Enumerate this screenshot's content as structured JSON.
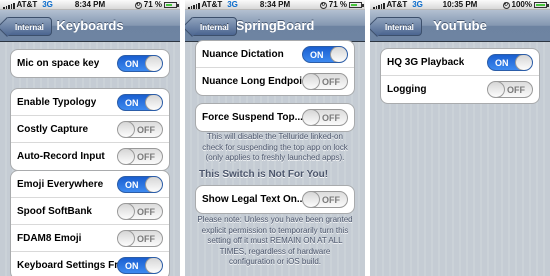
{
  "panels": [
    {
      "status": {
        "carrier": "AT&T",
        "network": "3G",
        "time": "8:34 PM",
        "battery": "71 %",
        "battery_level": 0.71
      },
      "nav": {
        "back_label": "Internal",
        "title": "Keyboards"
      },
      "groups": [
        [
          {
            "label": "Mic on space key",
            "state": "ON"
          }
        ],
        [
          {
            "label": "Enable Typology",
            "state": "ON"
          },
          {
            "label": "Costly Capture",
            "state": "OFF"
          },
          {
            "label": "Auto-Record Input",
            "state": "OFF"
          }
        ],
        [
          {
            "label": "Emoji Everywhere",
            "state": "ON"
          },
          {
            "label": "Spoof SoftBank",
            "state": "OFF"
          },
          {
            "label": "FDAM8 Emoji",
            "state": "OFF"
          },
          {
            "label": "Keyboard Settings Fr...",
            "state": "ON"
          }
        ]
      ]
    },
    {
      "status": {
        "carrier": "AT&T",
        "network": "3G",
        "time": "8:34 PM",
        "battery": "71 %",
        "battery_level": 0.71
      },
      "nav": {
        "back_label": "Internal",
        "title": "SpringBoard"
      },
      "groups": [
        [
          {
            "label": "Nuance Dictation",
            "state": "ON"
          },
          {
            "label": "Nuance Long Endpoi...",
            "state": "OFF"
          }
        ],
        [
          {
            "label": "Force Suspend Top...",
            "state": "OFF"
          }
        ],
        [
          {
            "label": "Show Legal Text On...",
            "state": "OFF"
          }
        ]
      ],
      "note_1": "This will disable the Telluride linked-on check for suspending the top app on lock (only applies to freshly launched apps).",
      "section_header": "This Switch is Not For You!",
      "note_2": "Please note: Unless you have been granted explicit permission to temporarily turn this setting off it must REMAIN ON AT ALL TIMES, regardless of hardware configuration or iOS build."
    },
    {
      "status": {
        "carrier": "AT&T",
        "network": "3G",
        "time": "10:35 PM",
        "battery": "100%",
        "battery_level": 1.0
      },
      "nav": {
        "back_label": "Internal",
        "title": "YouTube"
      },
      "groups": [
        [
          {
            "label": "HQ 3G Playback",
            "state": "ON"
          },
          {
            "label": "Logging",
            "state": "OFF"
          }
        ]
      ]
    }
  ]
}
